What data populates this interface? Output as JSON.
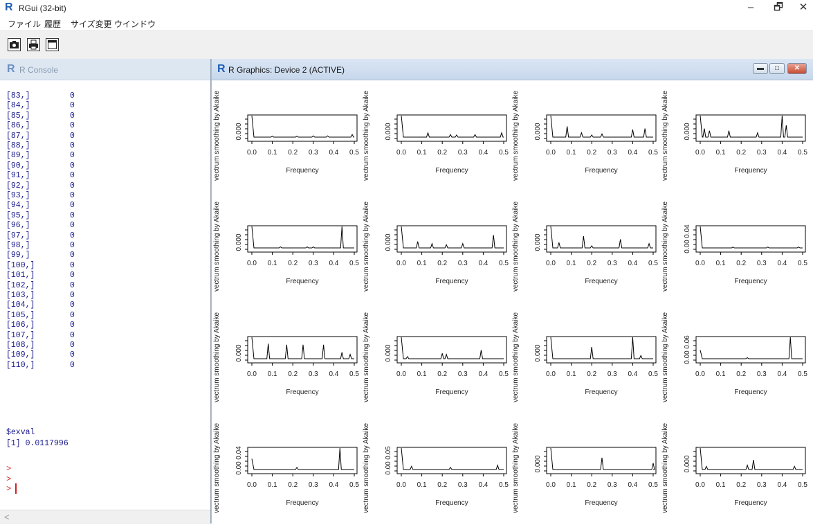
{
  "window": {
    "title": "RGui (32-bit)",
    "icon": "r-logo-icon"
  },
  "window_controls": {
    "minimize": "–",
    "restore": "🗗",
    "close": "✕"
  },
  "menu": [
    "ファイル",
    "履歴",
    "サイズ変更",
    "ウインドウ"
  ],
  "toolbar": {
    "buttons": [
      "camera-icon",
      "print-icon",
      "window-icon"
    ]
  },
  "console": {
    "title": "R Console",
    "rows": [
      {
        "index": "[83,]",
        "value": "0"
      },
      {
        "index": "[84,]",
        "value": "0"
      },
      {
        "index": "[85,]",
        "value": "0"
      },
      {
        "index": "[86,]",
        "value": "0"
      },
      {
        "index": "[87,]",
        "value": "0"
      },
      {
        "index": "[88,]",
        "value": "0"
      },
      {
        "index": "[89,]",
        "value": "0"
      },
      {
        "index": "[90,]",
        "value": "0"
      },
      {
        "index": "[91,]",
        "value": "0"
      },
      {
        "index": "[92,]",
        "value": "0"
      },
      {
        "index": "[93,]",
        "value": "0"
      },
      {
        "index": "[94,]",
        "value": "0"
      },
      {
        "index": "[95,]",
        "value": "0"
      },
      {
        "index": "[96,]",
        "value": "0"
      },
      {
        "index": "[97,]",
        "value": "0"
      },
      {
        "index": "[98,]",
        "value": "0"
      },
      {
        "index": "[99,]",
        "value": "0"
      },
      {
        "index": "[100,]",
        "value": "0"
      },
      {
        "index": "[101,]",
        "value": "0"
      },
      {
        "index": "[102,]",
        "value": "0"
      },
      {
        "index": "[103,]",
        "value": "0"
      },
      {
        "index": "[104,]",
        "value": "0"
      },
      {
        "index": "[105,]",
        "value": "0"
      },
      {
        "index": "[106,]",
        "value": "0"
      },
      {
        "index": "[107,]",
        "value": "0"
      },
      {
        "index": "[108,]",
        "value": "0"
      },
      {
        "index": "[109,]",
        "value": "0"
      },
      {
        "index": "[110,]",
        "value": "0"
      }
    ],
    "exval_label": "$exval",
    "exval_value": "[1] 0.0117996",
    "prompts": [
      ">",
      ">",
      ">"
    ],
    "scroll_left": "<"
  },
  "graphics": {
    "title": "R Graphics: Device 2 (ACTIVE)",
    "buttons": {
      "minimize": "▬",
      "maximize": "□",
      "close": "✕"
    }
  },
  "chart_data": {
    "type": "line",
    "layout": "4x4 grid of spectrum plots",
    "xlabel": "Frequency",
    "ylabel": "vectrum smoothing by Akaike",
    "x_ticks": [
      "0.0",
      "0.1",
      "0.2",
      "0.3",
      "0.4",
      "0.5"
    ],
    "xlim": [
      0,
      0.5
    ],
    "panels": [
      {
        "y_ticks": [
          "0.000"
        ],
        "peaks": [
          [
            0.0,
            1.0
          ],
          [
            0.1,
            0.05
          ],
          [
            0.22,
            0.05
          ],
          [
            0.3,
            0.06
          ],
          [
            0.37,
            0.06
          ],
          [
            0.49,
            0.12
          ]
        ]
      },
      {
        "y_ticks": [
          "0.000"
        ],
        "peaks": [
          [
            0.0,
            1.0
          ],
          [
            0.13,
            0.2
          ],
          [
            0.24,
            0.12
          ],
          [
            0.27,
            0.1
          ],
          [
            0.36,
            0.12
          ],
          [
            0.49,
            0.2
          ]
        ]
      },
      {
        "y_ticks": [
          "0.000"
        ],
        "peaks": [
          [
            0.0,
            1.0
          ],
          [
            0.08,
            0.5
          ],
          [
            0.15,
            0.2
          ],
          [
            0.2,
            0.1
          ],
          [
            0.25,
            0.15
          ],
          [
            0.4,
            0.35
          ],
          [
            0.46,
            0.4
          ]
        ]
      },
      {
        "y_ticks": [
          "0.000"
        ],
        "peaks": [
          [
            0.0,
            1.0
          ],
          [
            0.02,
            0.4
          ],
          [
            0.045,
            0.3
          ],
          [
            0.14,
            0.3
          ],
          [
            0.28,
            0.2
          ],
          [
            0.4,
            1.0
          ],
          [
            0.42,
            0.55
          ]
        ]
      },
      {
        "y_ticks": [
          "0.000"
        ],
        "peaks": [
          [
            0.0,
            1.0
          ],
          [
            0.14,
            0.05
          ],
          [
            0.27,
            0.05
          ],
          [
            0.3,
            0.05
          ],
          [
            0.44,
            1.0
          ]
        ]
      },
      {
        "y_ticks": [
          "0.000"
        ],
        "peaks": [
          [
            0.0,
            1.0
          ],
          [
            0.08,
            0.3
          ],
          [
            0.15,
            0.2
          ],
          [
            0.22,
            0.15
          ],
          [
            0.3,
            0.2
          ],
          [
            0.45,
            0.6
          ]
        ]
      },
      {
        "y_ticks": [
          "0.000"
        ],
        "peaks": [
          [
            0.0,
            1.0
          ],
          [
            0.04,
            0.25
          ],
          [
            0.16,
            0.55
          ],
          [
            0.2,
            0.1
          ],
          [
            0.34,
            0.4
          ],
          [
            0.48,
            0.2
          ]
        ]
      },
      {
        "y_ticks": [
          "0.00",
          "0.04"
        ],
        "peaks": [
          [
            0.0,
            1.0
          ],
          [
            0.16,
            0.04
          ],
          [
            0.33,
            0.04
          ],
          [
            0.48,
            0.04
          ]
        ]
      },
      {
        "y_ticks": [
          "0.000"
        ],
        "peaks": [
          [
            0.0,
            1.0
          ],
          [
            0.08,
            0.7
          ],
          [
            0.17,
            0.65
          ],
          [
            0.25,
            0.65
          ],
          [
            0.35,
            0.65
          ],
          [
            0.44,
            0.3
          ],
          [
            0.48,
            0.2
          ]
        ]
      },
      {
        "y_ticks": [
          "0.000"
        ],
        "peaks": [
          [
            0.0,
            1.0
          ],
          [
            0.03,
            0.1
          ],
          [
            0.2,
            0.25
          ],
          [
            0.22,
            0.2
          ],
          [
            0.39,
            0.4
          ]
        ]
      },
      {
        "y_ticks": [
          "0.000"
        ],
        "peaks": [
          [
            0.0,
            1.0
          ],
          [
            0.2,
            0.55
          ],
          [
            0.4,
            1.0
          ],
          [
            0.44,
            0.15
          ]
        ]
      },
      {
        "y_ticks": [
          "0.00",
          "0.06"
        ],
        "peaks": [
          [
            0.0,
            0.4
          ],
          [
            0.23,
            0.05
          ],
          [
            0.44,
            1.0
          ]
        ]
      },
      {
        "y_ticks": [
          "0.00",
          "0.04"
        ],
        "peaks": [
          [
            0.0,
            0.5
          ],
          [
            0.22,
            0.1
          ],
          [
            0.43,
            1.0
          ]
        ]
      },
      {
        "y_ticks": [
          "0.00",
          "0.05"
        ],
        "peaks": [
          [
            0.0,
            1.0
          ],
          [
            0.05,
            0.15
          ],
          [
            0.24,
            0.1
          ],
          [
            0.47,
            0.2
          ]
        ]
      },
      {
        "y_ticks": [
          "0.000"
        ],
        "peaks": [
          [
            0.0,
            1.0
          ],
          [
            0.25,
            0.55
          ],
          [
            0.5,
            0.3
          ]
        ]
      },
      {
        "y_ticks": [
          "0.000"
        ],
        "peaks": [
          [
            0.0,
            1.0
          ],
          [
            0.03,
            0.15
          ],
          [
            0.23,
            0.2
          ],
          [
            0.26,
            0.45
          ],
          [
            0.46,
            0.15
          ]
        ]
      }
    ]
  }
}
